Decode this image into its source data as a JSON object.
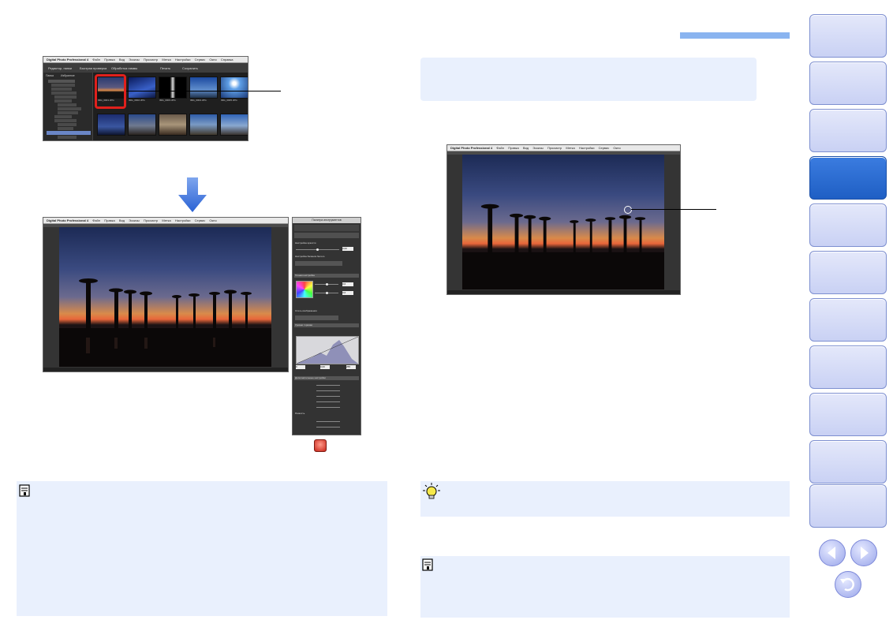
{
  "app": {
    "title": "Digital Photo Professional 4",
    "menu": [
      "Файл",
      "Правка",
      "Вид",
      "Эскизы",
      "Просмотр",
      "Метка",
      "Настройки",
      "Сервис",
      "Окно",
      "Справка"
    ]
  },
  "browser": {
    "toolbar": [
      "Редактор, папки",
      "Быстрая проверка",
      "Обработка гаммы",
      "Печать",
      "Сохранить"
    ],
    "tabs": [
      "Папка",
      "Избранное"
    ],
    "thumbs": [
      "IMG_0001.JPG",
      "IMG_0002.JPG",
      "IMG_0003.JPG",
      "IMG_0004.JPG",
      "IMG_0005.JPG"
    ]
  },
  "colors": {
    "accent": "#1f5fc4",
    "nav_tab": "#d6dcf7",
    "note_bg": "#e9f0fd",
    "highlight": "#e0201c",
    "bar": "#8ab4f0"
  },
  "palette": {
    "title": "Палитра инструментов",
    "rows": [
      "Настройка яркости",
      "Настройка баланса белого",
      "Точная настройка",
      "Стиль изображения",
      "Уровни / кривая",
      "Дополнительные настройки",
      "Резкость"
    ],
    "values": [
      "0,00",
      "0,0",
      "0,0",
      "0",
      "0,00",
      "0",
      "255"
    ]
  },
  "icons": {
    "note": "memo-icon",
    "tip": "lightbulb-icon",
    "prev": "arrow-left-icon",
    "next": "arrow-right-icon",
    "back": "return-icon"
  }
}
